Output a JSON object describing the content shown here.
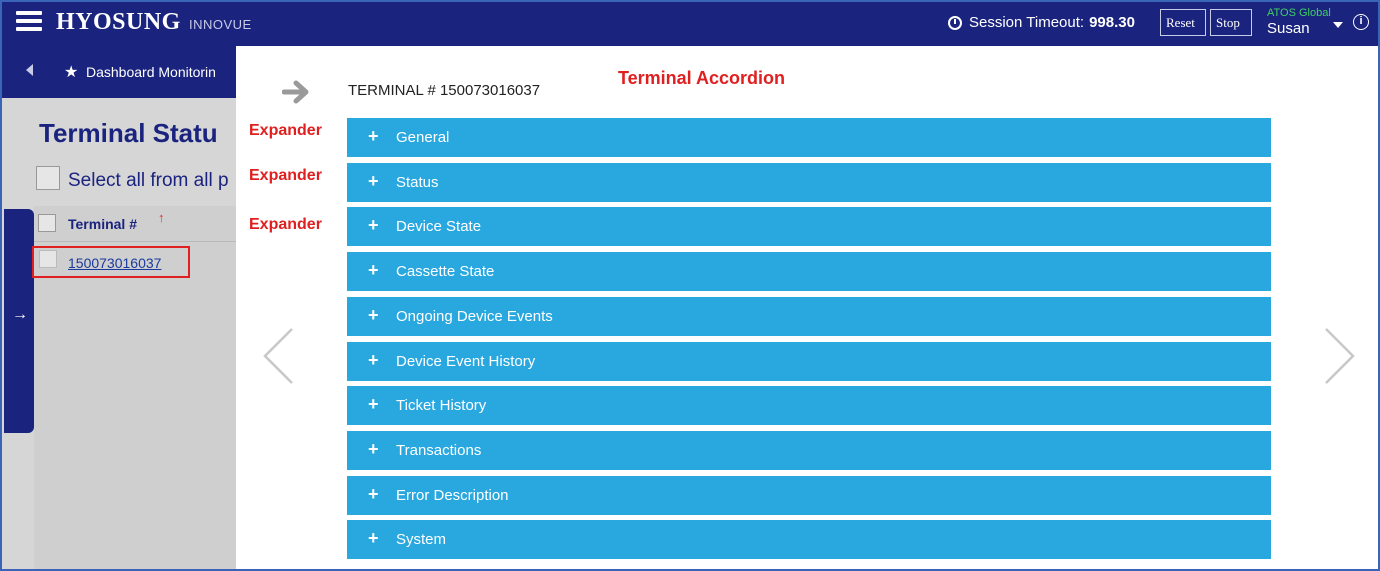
{
  "header": {
    "brand": "HYOSUNG",
    "brand_sub": "INNOVUE",
    "session_label": "Session Timeout:",
    "session_value": "998.30",
    "reset_label": "Reset",
    "stop_label": "Stop",
    "org": "ATOS Global",
    "user": "Susan"
  },
  "background": {
    "nav_label": "Dashboard Monitorin",
    "page_title": "Terminal Statu",
    "select_all": "Select all from all p",
    "column_header": "Terminal #",
    "sort_icon": "↑",
    "row_link": "150073016037"
  },
  "panel": {
    "terminal_title": "TERMINAL # 150073016037",
    "annotation_main": "Terminal Accordion",
    "expander_label": "Expander",
    "accordion": [
      {
        "label": "General"
      },
      {
        "label": "Status"
      },
      {
        "label": "Device State"
      },
      {
        "label": "Cassette State"
      },
      {
        "label": "Ongoing Device Events"
      },
      {
        "label": "Device Event History"
      },
      {
        "label": "Ticket History"
      },
      {
        "label": "Transactions"
      },
      {
        "label": "Error Description"
      },
      {
        "label": "System"
      }
    ]
  },
  "icons": {
    "hamburger": "hamburger-icon",
    "clock": "clock-icon",
    "info": "info-icon",
    "star": "star-icon",
    "forward": "forward-arrow-icon",
    "prev": "chevron-left-icon",
    "next": "chevron-right-icon",
    "plus": "plus-icon"
  },
  "colors": {
    "header_bg": "#1a237e",
    "accordion_bg": "#29a8e0",
    "annotation": "#e02020",
    "org_text": "#3fd062"
  }
}
